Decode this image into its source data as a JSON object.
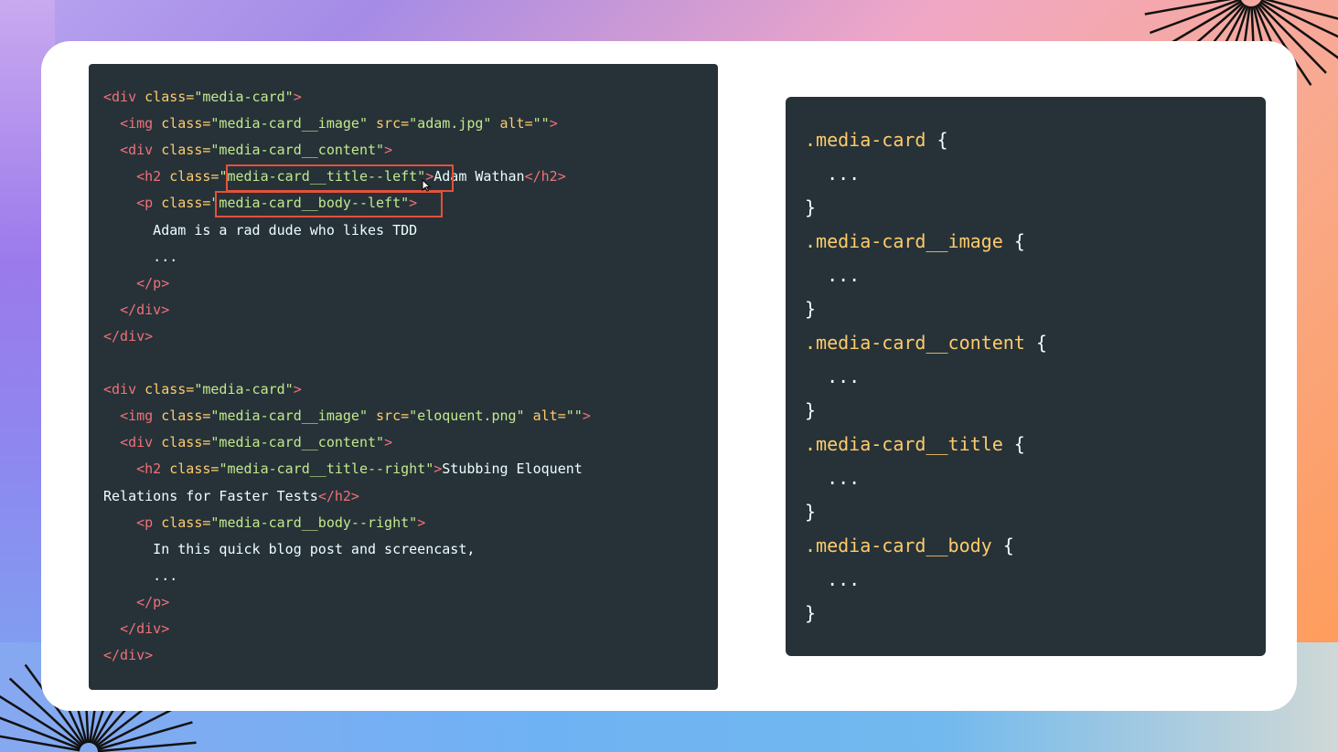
{
  "left_code": {
    "lines": [
      [
        {
          "c": "tg",
          "t": "<div "
        },
        {
          "c": "at",
          "t": "class="
        },
        {
          "c": "st",
          "t": "\"media-card\""
        },
        {
          "c": "tg",
          "t": ">"
        }
      ],
      [
        {
          "c": "tx",
          "t": "  "
        },
        {
          "c": "tg",
          "t": "<img "
        },
        {
          "c": "at",
          "t": "class="
        },
        {
          "c": "st",
          "t": "\"media-card__image\""
        },
        {
          "c": "at",
          "t": " src="
        },
        {
          "c": "st",
          "t": "\"adam.jpg\""
        },
        {
          "c": "at",
          "t": " alt="
        },
        {
          "c": "st",
          "t": "\"\""
        },
        {
          "c": "tg",
          "t": ">"
        }
      ],
      [
        {
          "c": "tx",
          "t": "  "
        },
        {
          "c": "tg",
          "t": "<div "
        },
        {
          "c": "at",
          "t": "class="
        },
        {
          "c": "st",
          "t": "\"media-card__content\""
        },
        {
          "c": "tg",
          "t": ">"
        }
      ],
      [
        {
          "c": "tx",
          "t": "    "
        },
        {
          "c": "tg",
          "t": "<h2 "
        },
        {
          "c": "at",
          "t": "class="
        },
        {
          "c": "st",
          "t": "\"media-card__title--left\""
        },
        {
          "c": "tg",
          "t": ">"
        },
        {
          "c": "tx",
          "t": "Adam Wathan"
        },
        {
          "c": "tg",
          "t": "</h2>"
        }
      ],
      [
        {
          "c": "tx",
          "t": "    "
        },
        {
          "c": "tg",
          "t": "<p "
        },
        {
          "c": "at",
          "t": "class="
        },
        {
          "c": "st",
          "t": "\"media-card__body--left\""
        },
        {
          "c": "tg",
          "t": ">"
        }
      ],
      [
        {
          "c": "tx",
          "t": "      Adam is a rad dude who likes TDD"
        }
      ],
      [
        {
          "c": "tx",
          "t": "      ..."
        }
      ],
      [
        {
          "c": "tx",
          "t": "    "
        },
        {
          "c": "tg",
          "t": "</p>"
        }
      ],
      [
        {
          "c": "tx",
          "t": "  "
        },
        {
          "c": "tg",
          "t": "</div>"
        }
      ],
      [
        {
          "c": "tg",
          "t": "</div>"
        }
      ],
      [],
      [
        {
          "c": "tg",
          "t": "<div "
        },
        {
          "c": "at",
          "t": "class="
        },
        {
          "c": "st",
          "t": "\"media-card\""
        },
        {
          "c": "tg",
          "t": ">"
        }
      ],
      [
        {
          "c": "tx",
          "t": "  "
        },
        {
          "c": "tg",
          "t": "<img "
        },
        {
          "c": "at",
          "t": "class="
        },
        {
          "c": "st",
          "t": "\"media-card__image\""
        },
        {
          "c": "at",
          "t": " src="
        },
        {
          "c": "st",
          "t": "\"eloquent.png\""
        },
        {
          "c": "at",
          "t": " alt="
        },
        {
          "c": "st",
          "t": "\"\""
        },
        {
          "c": "tg",
          "t": ">"
        }
      ],
      [
        {
          "c": "tx",
          "t": "  "
        },
        {
          "c": "tg",
          "t": "<div "
        },
        {
          "c": "at",
          "t": "class="
        },
        {
          "c": "st",
          "t": "\"media-card__content\""
        },
        {
          "c": "tg",
          "t": ">"
        }
      ],
      [
        {
          "c": "tx",
          "t": "    "
        },
        {
          "c": "tg",
          "t": "<h2 "
        },
        {
          "c": "at",
          "t": "class="
        },
        {
          "c": "st",
          "t": "\"media-card__title--right\""
        },
        {
          "c": "tg",
          "t": ">"
        },
        {
          "c": "tx",
          "t": "Stubbing Eloquent"
        }
      ],
      [
        {
          "c": "tx",
          "t": "Relations for Faster Tests"
        },
        {
          "c": "tg",
          "t": "</h2>"
        }
      ],
      [
        {
          "c": "tx",
          "t": "    "
        },
        {
          "c": "tg",
          "t": "<p "
        },
        {
          "c": "at",
          "t": "class="
        },
        {
          "c": "st",
          "t": "\"media-card__body--right\""
        },
        {
          "c": "tg",
          "t": ">"
        }
      ],
      [
        {
          "c": "tx",
          "t": "      In this quick blog post and screencast,"
        }
      ],
      [
        {
          "c": "tx",
          "t": "      ..."
        }
      ],
      [
        {
          "c": "tx",
          "t": "    "
        },
        {
          "c": "tg",
          "t": "</p>"
        }
      ],
      [
        {
          "c": "tx",
          "t": "  "
        },
        {
          "c": "tg",
          "t": "</div>"
        }
      ],
      [
        {
          "c": "tg",
          "t": "</div>"
        }
      ]
    ]
  },
  "right_code": {
    "lines": [
      [
        {
          "c": "sel",
          "t": ".media-card"
        },
        {
          "c": "pu",
          "t": " {"
        }
      ],
      [
        {
          "c": "pu",
          "t": "  ..."
        }
      ],
      [
        {
          "c": "pu",
          "t": "}"
        }
      ],
      [
        {
          "c": "sel",
          "t": ".media-card__image"
        },
        {
          "c": "pu",
          "t": " {"
        }
      ],
      [
        {
          "c": "pu",
          "t": "  ..."
        }
      ],
      [
        {
          "c": "pu",
          "t": "}"
        }
      ],
      [
        {
          "c": "sel",
          "t": ".media-card__content"
        },
        {
          "c": "pu",
          "t": " {"
        }
      ],
      [
        {
          "c": "pu",
          "t": "  ..."
        }
      ],
      [
        {
          "c": "pu",
          "t": "}"
        }
      ],
      [
        {
          "c": "sel",
          "t": ".media-card__title"
        },
        {
          "c": "pu",
          "t": " {"
        }
      ],
      [
        {
          "c": "pu",
          "t": "  ..."
        }
      ],
      [
        {
          "c": "pu",
          "t": "}"
        }
      ],
      [
        {
          "c": "sel",
          "t": ".media-card__body"
        },
        {
          "c": "pu",
          "t": " {"
        }
      ],
      [
        {
          "c": "pu",
          "t": "  ..."
        }
      ],
      [
        {
          "c": "pu",
          "t": "}"
        }
      ]
    ]
  },
  "highlight_color": "#e5513a",
  "icons": {
    "cursor": "mouse-pointer-icon",
    "burst": "starburst-icon"
  }
}
